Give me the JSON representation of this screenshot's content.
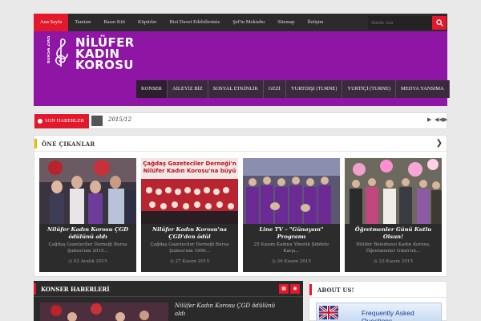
{
  "topnav": {
    "items": [
      "Ana Sayfa",
      "Tanıtım",
      "Basın Kiti",
      "Küpürler",
      "Bizi Davet Edebilirsiniz",
      "Şef'in Mektubu",
      "Sitemap",
      "İletişim"
    ]
  },
  "search": {
    "placeholder": "Sitede Ara"
  },
  "header": {
    "logo_line1": "NİLÜFER",
    "logo_line2": "KADIN",
    "logo_line3": "KOROSU",
    "logo_side": "BURSA 2005"
  },
  "mainnav": {
    "items": [
      "KONSER",
      "AİLEYİZ BİZ",
      "SOSYAL ETKİNLİK",
      "GEZİ",
      "YURTDIŞI (TURNE)",
      "YURTİÇİ (TURNE)",
      "MEDYA YANSIMA"
    ]
  },
  "ticker": {
    "label": "SON HABERLER",
    "text": "2015/12"
  },
  "featured": {
    "title": "ÖNE ÇIKANLAR",
    "cards": [
      {
        "title": "Nilüfer Kadın Korosu ÇGD ödülünü aldı",
        "excerpt": "Çağdaş Gazeteciler Derneği Bursa Şubesi'nin 2015...",
        "date": "02 Aralık 2015",
        "overlay": ""
      },
      {
        "title": "Nilüfer Kadın Korosu'na ÇGD'den ödül",
        "excerpt": "Çağdaş Gazeteciler Derneği Bursa Şubesi'nin 1990...",
        "date": "27 Kasım 2015",
        "overlay": "Çağdaş Gazeteciler Derneği'n Nilüfer Kadın Korosu'na büyü"
      },
      {
        "title": "Line TV – \"Günaysın\" Programı",
        "excerpt": "25 Kasım Kadına Yönelik Şiddete Karşı...",
        "date": "26 Kasım 2015",
        "overlay": ""
      },
      {
        "title": "Öğretmenler Günü Kutlu Olsun!",
        "excerpt": "Nilüfer Belediyesi Kadın Korosu, Öğretmenler Günü'nü...",
        "date": "23 Kasım 2015",
        "overlay": ""
      }
    ]
  },
  "konser": {
    "title": "KONSER HABERLERİ",
    "item_title": "Nilüfer Kadın Korosu ÇGD ödülünü aldı"
  },
  "about": {
    "title": "ABOUT US!",
    "faq": "Frequently Asked Questions"
  },
  "colors": {
    "accent": "#e2182b",
    "header_purple": "#8f15a5",
    "dark": "#2b2b2b",
    "yellow_bar": "#f2b600"
  }
}
